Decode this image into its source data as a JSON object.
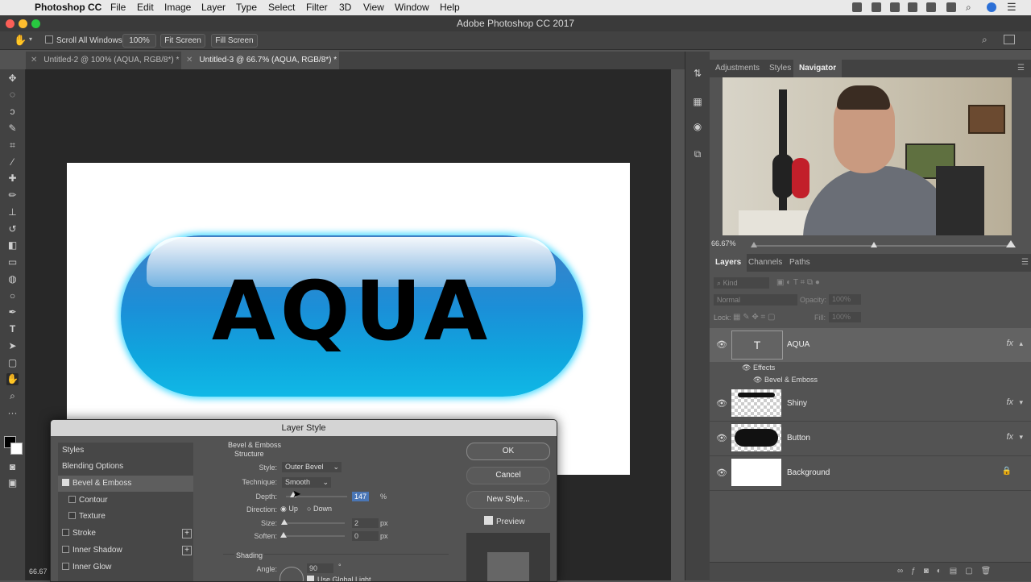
{
  "menubar": {
    "app": "Photoshop CC",
    "items": [
      "File",
      "Edit",
      "Image",
      "Layer",
      "Type",
      "Select",
      "Filter",
      "3D",
      "View",
      "Window",
      "Help"
    ]
  },
  "window": {
    "title": "Adobe Photoshop CC 2017"
  },
  "options": {
    "scroll_all": "Scroll All Windows",
    "zoom_100": "100%",
    "fit_screen": "Fit Screen",
    "fill_screen": "Fill Screen"
  },
  "tabs": [
    {
      "label": "Untitled-2 @ 100% (AQUA, RGB/8*) *",
      "active": false
    },
    {
      "label": "Untitled-3 @ 66.7% (AQUA, RGB/8*) *",
      "active": true
    }
  ],
  "canvas": {
    "text": "AQUA",
    "zoom": "66.67"
  },
  "panels": {
    "top_tabs": [
      "Adjustments",
      "Styles",
      "Navigator"
    ],
    "navigator_zoom": "66.67%",
    "layer_tabs": [
      "Layers",
      "Channels",
      "Paths"
    ],
    "kind": "Kind",
    "blend_mode": "Normal",
    "opacity_label": "Opacity:",
    "opacity_value": "100%",
    "lock_label": "Lock:",
    "fill_label": "Fill:",
    "fill_value": "100%",
    "layers": [
      {
        "name": "AQUA",
        "fx": "fx"
      },
      {
        "name": "Shiny",
        "fx": "fx"
      },
      {
        "name": "Button",
        "fx": "fx"
      },
      {
        "name": "Background",
        "fx": ""
      }
    ],
    "effects_label": "Effects",
    "bevel_effect": "Bevel & Emboss",
    "thumb_text": "T"
  },
  "dialog": {
    "title": "Layer Style",
    "styles": [
      {
        "label": "Styles",
        "check": false,
        "plus": false
      },
      {
        "label": "Blending Options",
        "check": false,
        "plus": false
      },
      {
        "label": "Bevel & Emboss",
        "check": true,
        "plus": false
      },
      {
        "label": "Contour",
        "check": false,
        "plus": false
      },
      {
        "label": "Texture",
        "check": false,
        "plus": false
      },
      {
        "label": "Stroke",
        "check": false,
        "plus": true
      },
      {
        "label": "Inner Shadow",
        "check": false,
        "plus": true
      },
      {
        "label": "Inner Glow",
        "check": false,
        "plus": false
      }
    ],
    "section": "Bevel & Emboss",
    "structure": "Structure",
    "style_label": "Style:",
    "style_value": "Outer Bevel",
    "technique_label": "Technique:",
    "technique_value": "Smooth",
    "depth_label": "Depth:",
    "depth_value": "147",
    "percent": "%",
    "direction_label": "Direction:",
    "dir_up": "Up",
    "dir_down": "Down",
    "size_label": "Size:",
    "size_value": "2",
    "soften_label": "Soften:",
    "soften_value": "0",
    "px": "px",
    "shading": "Shading",
    "angle_label": "Angle:",
    "angle_value": "90",
    "degree": "°",
    "global_light": "Use Global Light",
    "ok": "OK",
    "cancel": "Cancel",
    "new_style": "New Style...",
    "preview": "Preview"
  }
}
